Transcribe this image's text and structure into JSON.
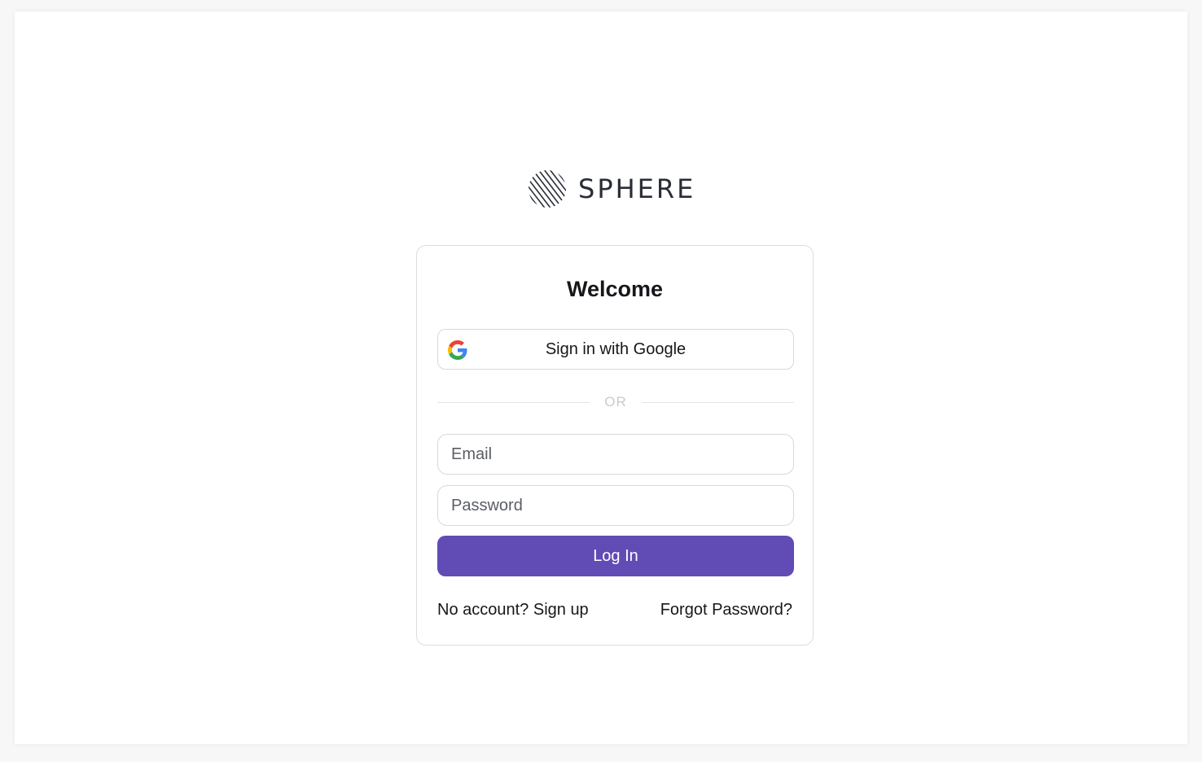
{
  "logo": {
    "name": "SPHERE",
    "mark_icon": "striped-sphere-icon"
  },
  "card": {
    "title": "Welcome",
    "google_button": {
      "label": "Sign in with Google",
      "icon": "google-g-icon"
    },
    "divider_text": "OR",
    "email": {
      "placeholder": "Email",
      "value": ""
    },
    "password": {
      "placeholder": "Password",
      "value": ""
    },
    "login_button": {
      "label": "Log In"
    },
    "signup_link": "No account? Sign up",
    "forgot_link": "Forgot Password?"
  },
  "colors": {
    "primary": "#614bb4",
    "border": "#d8d9dd",
    "text": "#16171a",
    "logo_text": "#2a2d36"
  }
}
